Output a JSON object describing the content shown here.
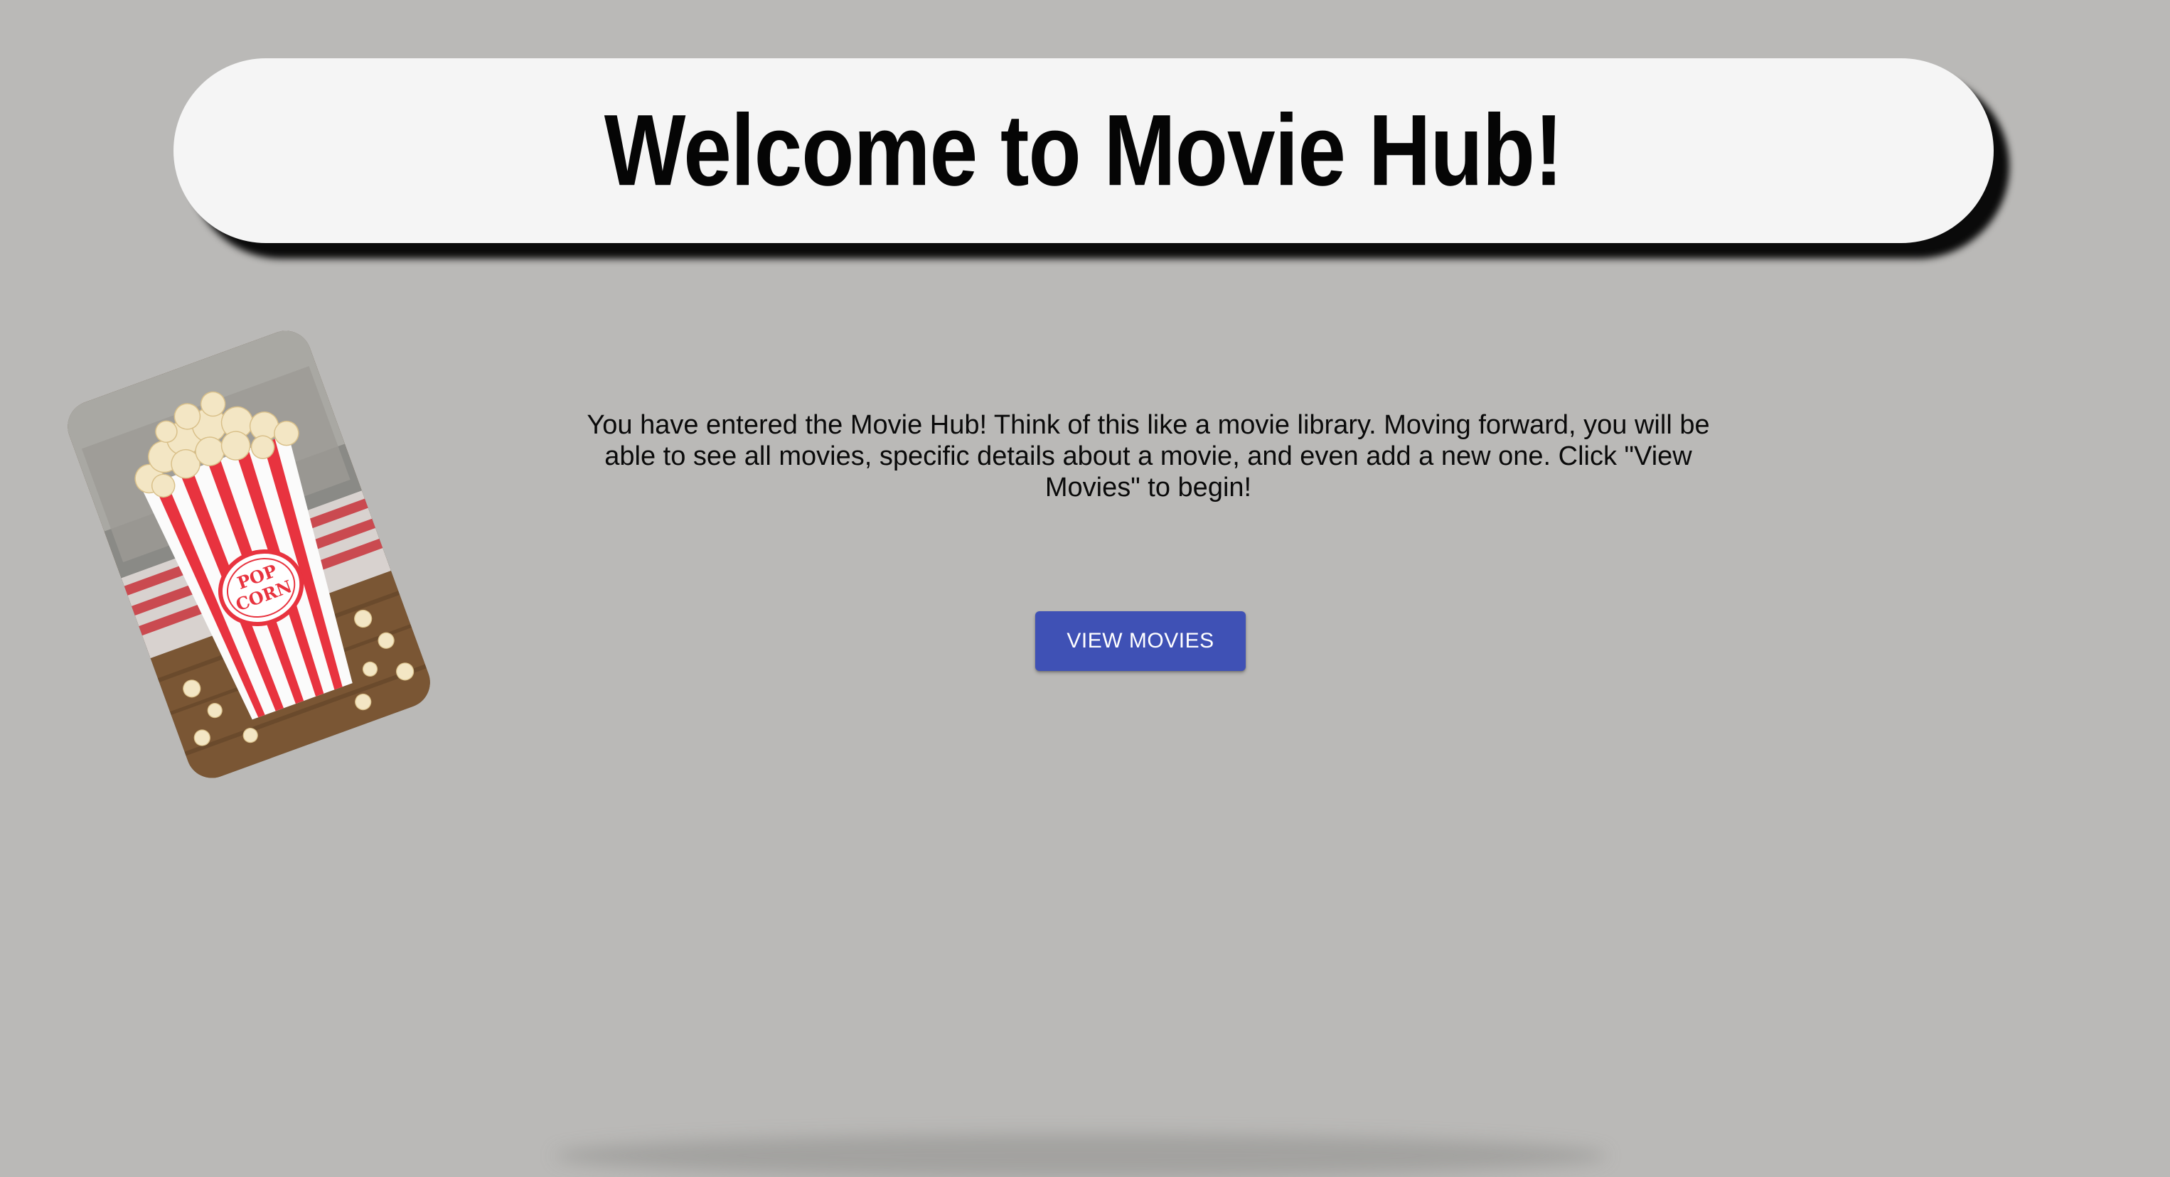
{
  "header": {
    "title": "Welcome to Movie Hub!"
  },
  "main": {
    "intro": "You have entered the Movie Hub! Think of this like a movie library. Moving forward, you will be able to see all movies, specific details about a movie, and even add a new one. Click \"View Movies\" to begin!",
    "view_button_label": "VIEW MOVIES"
  },
  "image": {
    "popcorn_text_line1": "POP",
    "popcorn_text_line2": "CORN"
  },
  "colors": {
    "background": "#bab9b7",
    "header_pill": "#f5f5f5",
    "button": "#3f51b5",
    "popcorn_stripe": "#e8333f"
  }
}
